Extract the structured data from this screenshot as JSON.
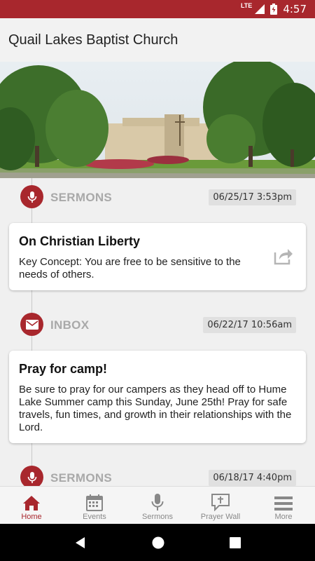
{
  "status_bar": {
    "network": "LTE",
    "time": "4:57"
  },
  "app_bar": {
    "title": "Quail Lakes Baptist Church"
  },
  "feed": [
    {
      "section": "SERMONS",
      "date": "06/25/17 3:53pm",
      "icon": "microphone-icon",
      "card": {
        "title": "On Christian Liberty",
        "body": "Key Concept: You are free to be sensitive to the needs of others."
      }
    },
    {
      "section": "INBOX",
      "date": "06/22/17 10:56am",
      "icon": "envelope-icon",
      "card": {
        "title": "Pray for camp!",
        "body": "Be sure to pray for our campers as they head off to Hume Lake Summer camp this Sunday, June 25th! Pray for safe travels, fun times, and growth in their relationships with the Lord."
      }
    },
    {
      "section": "SERMONS",
      "date": "06/18/17 4:40pm",
      "icon": "microphone-icon"
    }
  ],
  "bottom_nav": [
    {
      "label": "Home",
      "icon": "home-icon",
      "active": true
    },
    {
      "label": "Events",
      "icon": "calendar-icon"
    },
    {
      "label": "Sermons",
      "icon": "microphone-icon"
    },
    {
      "label": "Prayer Wall",
      "icon": "prayer-bubble-icon"
    },
    {
      "label": "More",
      "icon": "menu-icon"
    }
  ],
  "colors": {
    "accent": "#a8272d",
    "inactive": "#888888",
    "section_label": "#a9a9a9"
  }
}
